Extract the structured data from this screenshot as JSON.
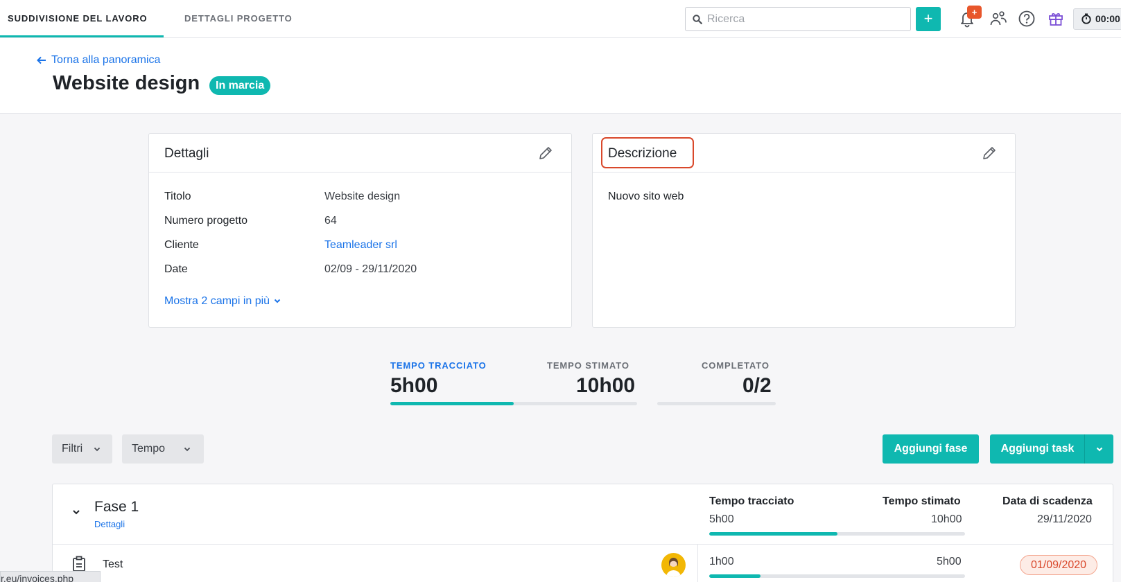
{
  "nav": {
    "tabs": [
      {
        "label": "SUDDIVISIONE DEL LAVORO",
        "active": true
      },
      {
        "label": "DETTAGLI PROGETTO",
        "active": false
      }
    ],
    "search_placeholder": "Ricerca",
    "add_label": "+",
    "notification_badge": "+",
    "timer": "00:00",
    "icons": [
      "search-icon",
      "bell-icon",
      "people-icon",
      "help-icon",
      "gift-icon",
      "stopwatch-icon"
    ]
  },
  "header": {
    "back_link": "Torna alla panoramica",
    "title": "Website design",
    "status": "In marcia"
  },
  "details": {
    "title": "Dettagli",
    "rows": [
      {
        "label": "Titolo",
        "value": "Website design"
      },
      {
        "label": "Numero progetto",
        "value": "64"
      },
      {
        "label": "Cliente",
        "value": "Teamleader srl"
      },
      {
        "label": "Date",
        "value": "02/09 - 29/11/2020"
      }
    ],
    "more_link": "Mostra 2 campi in più"
  },
  "description": {
    "title": "Descrizione",
    "text": "Nuovo sito web"
  },
  "stats": {
    "tracked_label": "TEMPO TRACCIATO",
    "tracked_value": "5h00",
    "estimated_label": "TEMPO STIMATO",
    "estimated_value": "10h00",
    "time_progress": 0.5,
    "completed_label": "COMPLETATO",
    "completed_value": "0/2",
    "completed_progress": 0
  },
  "toolbar": {
    "filters_label": "Filtri",
    "time_label": "Tempo",
    "add_phase_label": "Aggiungi fase",
    "add_task_label": "Aggiungi task"
  },
  "phase": {
    "title": "Fase 1",
    "details_link": "Dettagli",
    "tracked_head": "Tempo tracciato",
    "tracked_value": "5h00",
    "estimated_head": "Tempo stimato",
    "estimated_value": "10h00",
    "due_head": "Data di scadenza",
    "due_value": "29/11/2020",
    "progress": 0.5,
    "task": {
      "name": "Test",
      "tracked": "1h00",
      "estimated": "5h00",
      "progress": 0.2,
      "due": "01/09/2020"
    }
  },
  "statusbar": {
    "url": "r.eu/invoices.php"
  },
  "colors": {
    "accent": "#0fb8b0",
    "link": "#1a73e8",
    "warning": "#d9482b"
  }
}
